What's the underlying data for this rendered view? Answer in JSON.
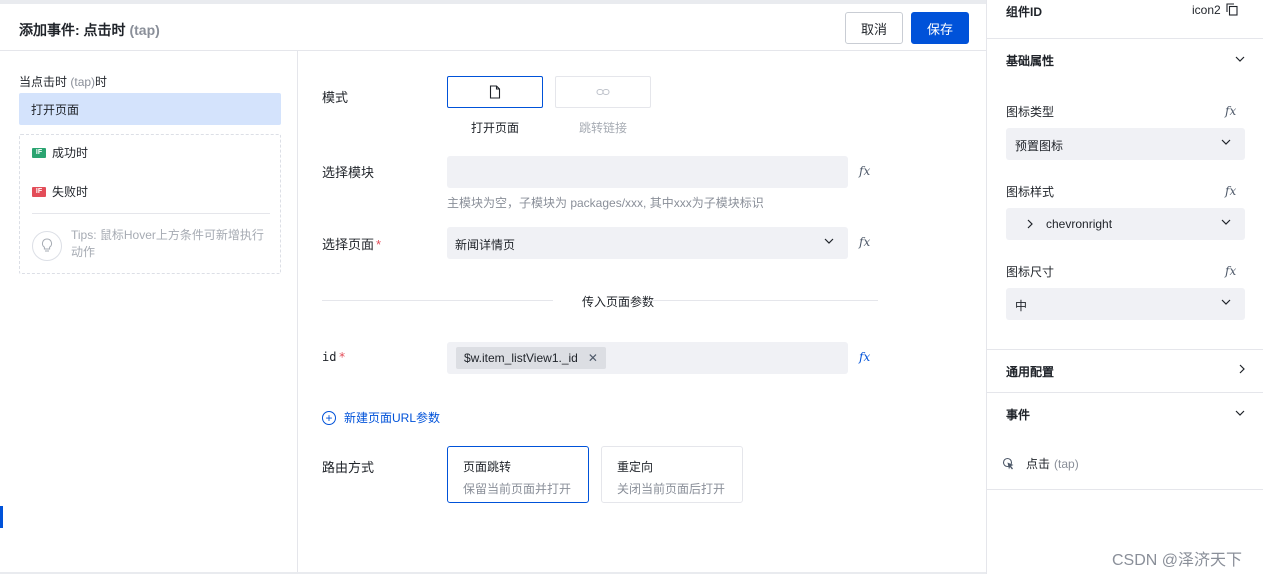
{
  "modal": {
    "title": "添加事件: 点击时",
    "title_sub": "(tap)",
    "cancel_label": "取消",
    "save_label": "保存"
  },
  "left": {
    "trigger_label": "当点击时",
    "trigger_sub": "(tap)",
    "trigger_suffix": "时",
    "action_label": "打开页面",
    "success_badge": "IF",
    "success_label": "成功时",
    "fail_badge": "IF",
    "fail_label": "失败时",
    "tips": "Tips: 鼠标Hover上方条件可新增执行动作"
  },
  "form": {
    "mode_label": "模式",
    "mode_options": [
      "打开页面",
      "跳转链接"
    ],
    "module_label": "选择模块",
    "module_value": "",
    "module_hint": "主模块为空，子模块为 packages/xxx, 其中xxx为子模块标识",
    "page_label": "选择页面",
    "page_value": "新闻详情页",
    "params_section": "传入页面参数",
    "param_name": "id",
    "param_tag": "$w.item_listView1._id",
    "add_param_label": "新建页面URL参数",
    "route_label": "路由方式",
    "route_options": [
      {
        "title": "页面跳转",
        "desc": "保留当前页面并打开"
      },
      {
        "title": "重定向",
        "desc": "关闭当前页面后打开"
      }
    ],
    "fx_label": "fx",
    "required_mark": "*"
  },
  "props": {
    "component_id_label": "组件ID",
    "component_id_value": "icon2",
    "basic_section": "基础属性",
    "icon_type_label": "图标类型",
    "icon_type_value": "预置图标",
    "icon_style_label": "图标样式",
    "icon_style_value": "chevronright",
    "icon_size_label": "图标尺寸",
    "icon_size_value": "中",
    "general_section": "通用配置",
    "events_section": "事件",
    "event_label": "点击",
    "event_sub": "(tap)"
  },
  "watermark": "CSDN @泽济天下",
  "colors": {
    "primary": "#0052d9",
    "success": "#2ba471",
    "danger": "#e34d59"
  }
}
